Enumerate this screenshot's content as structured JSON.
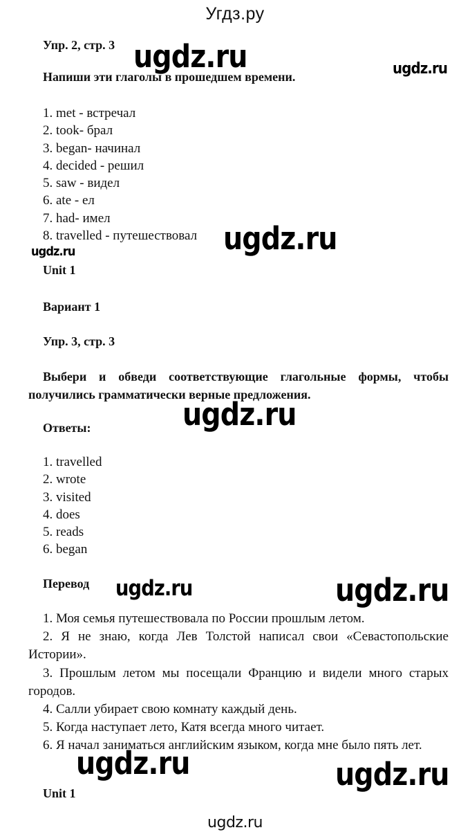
{
  "header": {
    "site_title": "Угдз.ру"
  },
  "exercise2": {
    "heading": "Упр. 2, стр. 3",
    "instruction": "Напиши эти глаголы в прошедшем времени.",
    "items": [
      "1. met - встречал",
      "2. took- брал",
      "3. began- начинал",
      "4. decided - решил",
      "5. saw - видел",
      "6. ate - ел",
      "7. had- имел",
      "8. travelled - путешествовал"
    ]
  },
  "unit_label_1": "Unit 1",
  "variant_label": "Вариант 1",
  "exercise3": {
    "heading": "Упр. 3, стр. 3",
    "instruction": "Выбери и обведи соответствующие глагольные формы, чтобы получились грамматически верные предложения.",
    "answers_label": "Ответы:",
    "answers": [
      "1. travelled",
      "2. wrote",
      "3. visited",
      "4. does",
      "5. reads",
      "6. began"
    ],
    "translation_label": "Перевод",
    "translation": [
      "1. Моя семья путешествовала по России прошлым летом.",
      "2. Я не знаю, когда Лев Толстой написал свои «Севастопольские Истории».",
      "3. Прошлым летом мы посещали Францию и видели много старых городов.",
      "4. Салли убирает свою комнату каждый день.",
      "5. Когда наступает лето, Катя всегда много читает.",
      "6. Я начал заниматься английским языком, когда мне было пять лет."
    ]
  },
  "unit_label_2": "Unit 1",
  "watermark": {
    "text": "ugdz.ru"
  },
  "footer": {
    "text": "ugdz.ru"
  }
}
